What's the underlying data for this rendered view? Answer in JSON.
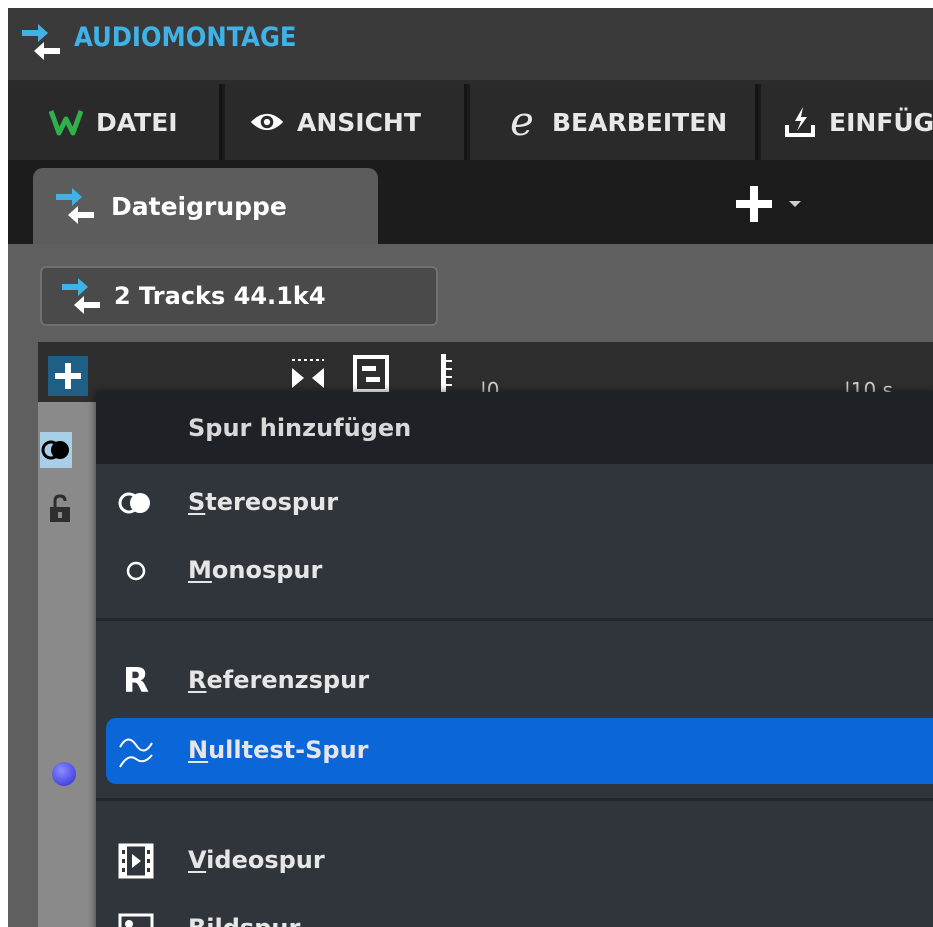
{
  "app": {
    "title": "AUDIOMONTAGE",
    "accent_color": "#3fb2e8"
  },
  "menu": {
    "items": [
      {
        "label": "DATEI",
        "icon": "wavelab-w-icon"
      },
      {
        "label": "ANSICHT",
        "icon": "eye-icon"
      },
      {
        "label": "BEARBEITEN",
        "icon": "edit-e-icon"
      },
      {
        "label": "EINFÜG",
        "icon": "insert-icon"
      }
    ]
  },
  "tabs": [
    {
      "label": "Dateigruppe",
      "icon": "montage-icon"
    }
  ],
  "montage": {
    "label": "2 Tracks 44.1k4"
  },
  "ruler": {
    "start": "0",
    "mark": "10 s"
  },
  "dropdown": {
    "header": "Spur hinzufügen",
    "items": [
      {
        "label": "Stereospur",
        "mnemonic": "S",
        "rest": "tereospur",
        "icon": "stereo-icon"
      },
      {
        "label": "Monospur",
        "mnemonic": "M",
        "rest": "onospur",
        "icon": "mono-circle-icon"
      },
      {
        "label": "Referenzspur",
        "mnemonic": "R",
        "rest": "eferenzspur",
        "icon": "reference-r-icon",
        "icon_text": "R"
      },
      {
        "label": "Nulltest-Spur",
        "mnemonic": "N",
        "rest": "ulltest-Spur",
        "icon": "null-test-wave-icon",
        "selected": true
      },
      {
        "label": "Videospur",
        "mnemonic": "V",
        "rest": "ideospur",
        "icon": "film-icon"
      },
      {
        "label": "Bildspur",
        "mnemonic": "B",
        "rest": "ildspur",
        "icon": "image-icon"
      }
    ],
    "selected_color": "#0b66d8"
  }
}
